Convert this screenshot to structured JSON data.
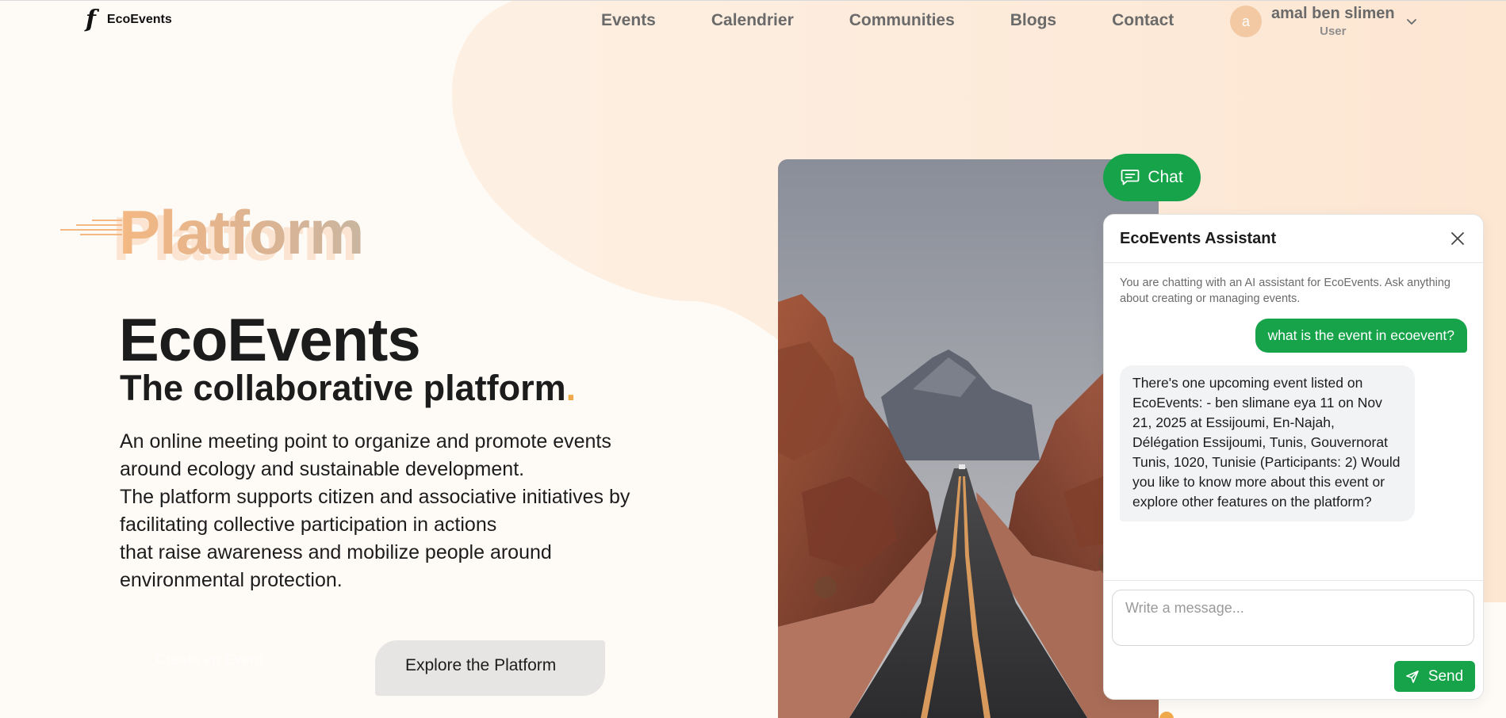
{
  "brand": {
    "logo_glyph": "f",
    "name": "EcoEvents"
  },
  "nav": {
    "items": [
      {
        "label": "Events"
      },
      {
        "label": "Calendrier"
      },
      {
        "label": "Communities"
      },
      {
        "label": "Blogs"
      },
      {
        "label": "Contact"
      }
    ]
  },
  "user": {
    "initial": "a",
    "name": "amal ben slimen",
    "role": "User"
  },
  "hero": {
    "kicker": "Platform",
    "title": "EcoEvents",
    "subtitle": "The collaborative platform",
    "subtitle_dot": ".",
    "description_lines": [
      "An online meeting point to organize and promote events",
      "around ecology and sustainable development.",
      "The platform supports citizen and associative initiatives by",
      "facilitating collective participation in actions",
      "that raise awareness and mobilize people around",
      "environmental protection."
    ],
    "create_label": "Create an Event",
    "create_arrow": "→",
    "explore_label": "Explore the Platform"
  },
  "chat": {
    "toggle_label": "Chat",
    "title": "EcoEvents Assistant",
    "intro": "You are chatting with an AI assistant for EcoEvents. Ask anything about creating or managing events.",
    "messages": [
      {
        "role": "user",
        "text": "what is the event in ecoevent?"
      },
      {
        "role": "assistant",
        "text": "There's one upcoming event listed on EcoEvents: - ben slimane eya 11 on Nov 21, 2025 at Essijoumi, En-Najah, Délégation Essijoumi, Tunis, Gouvernorat Tunis, 1020, Tunisie (Participants: 2) Would you like to know more about this event or explore other features on the platform?"
      }
    ],
    "input_placeholder": "Write a message...",
    "send_label": "Send"
  },
  "icons": {
    "chat": "chat-bubble-icon",
    "close": "close-icon",
    "send": "send-icon",
    "user_menu": "chevron-down-icon"
  },
  "colors": {
    "accent_green": "#17a34a",
    "accent_orange": "#f0a94a",
    "peach": "#fde9d8",
    "page_bg": "#fefbf6"
  }
}
